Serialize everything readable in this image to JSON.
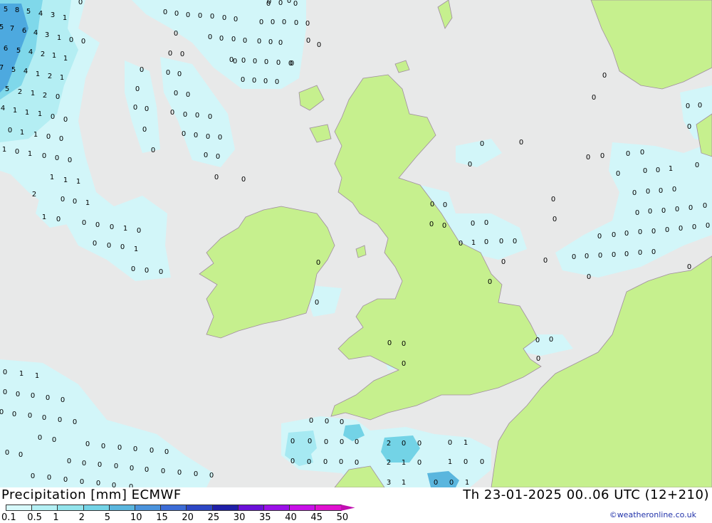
{
  "title": {
    "left": "Precipitation [mm] ECMWF",
    "right": "Th 23-01-2025 00..06 UTC (12+210)"
  },
  "credit": "©weatheronline.co.uk",
  "colors": {
    "sea": "#e8e9e9",
    "land": "#c6f08e",
    "coast": "#a08da0"
  },
  "legend": {
    "ticks": [
      "0.1",
      "0.5",
      "1",
      "2",
      "5",
      "10",
      "15",
      "20",
      "25",
      "30",
      "35",
      "40",
      "45",
      "50"
    ],
    "colors": [
      "#d7f9fb",
      "#b4f0f4",
      "#93e4ec",
      "#73d3e6",
      "#5ab6de",
      "#4a93dc",
      "#3c6cd6",
      "#2c46c4",
      "#1f1fa8",
      "#6a10d8",
      "#9a10e8",
      "#c810e8",
      "#e010d0",
      "#c010b0"
    ]
  },
  "map_values": [
    {
      "t": "5"
    },
    {
      "t": "8"
    },
    {
      "t": "5"
    },
    {
      "t": "4"
    },
    {
      "t": "3"
    },
    {
      "t": "1"
    },
    {
      "t": "0"
    },
    {
      "t": "5"
    },
    {
      "t": "7"
    },
    {
      "t": "6"
    },
    {
      "t": "4"
    },
    {
      "t": "3"
    },
    {
      "t": "1"
    },
    {
      "t": "0"
    },
    {
      "t": "0"
    },
    {
      "t": "6"
    },
    {
      "t": "5"
    },
    {
      "t": "4"
    },
    {
      "t": "2"
    },
    {
      "t": "1"
    },
    {
      "t": "1"
    },
    {
      "t": "7"
    },
    {
      "t": "5"
    },
    {
      "t": "4"
    },
    {
      "t": "1"
    },
    {
      "t": "2"
    },
    {
      "t": "1"
    },
    {
      "t": "5"
    },
    {
      "t": "2"
    },
    {
      "t": "1"
    },
    {
      "t": "2"
    },
    {
      "t": "0"
    },
    {
      "t": "4"
    },
    {
      "t": "1"
    },
    {
      "t": "1"
    },
    {
      "t": "1"
    },
    {
      "t": "0"
    },
    {
      "t": "0"
    },
    {
      "t": "0"
    },
    {
      "t": "1"
    },
    {
      "t": "1"
    },
    {
      "t": "0"
    },
    {
      "t": "0"
    },
    {
      "t": "1"
    },
    {
      "t": "0"
    },
    {
      "t": "1"
    },
    {
      "t": "0"
    },
    {
      "t": "0"
    },
    {
      "t": "0"
    },
    {
      "t": "1"
    },
    {
      "t": "1"
    },
    {
      "t": "1"
    },
    {
      "t": "2"
    },
    {
      "t": "0"
    },
    {
      "t": "0"
    },
    {
      "t": "1"
    },
    {
      "t": "1"
    },
    {
      "t": "0"
    },
    {
      "t": "0"
    },
    {
      "t": "0"
    },
    {
      "t": "0"
    },
    {
      "t": "1"
    },
    {
      "t": "0"
    },
    {
      "t": "0"
    },
    {
      "t": "0"
    },
    {
      "t": "0"
    },
    {
      "t": "1"
    },
    {
      "t": "0"
    },
    {
      "t": "0"
    },
    {
      "t": "0"
    },
    {
      "t": "0"
    },
    {
      "t": "0"
    },
    {
      "t": "0"
    },
    {
      "t": "0"
    },
    {
      "t": "0"
    },
    {
      "t": "0"
    },
    {
      "t": "0"
    },
    {
      "t": "0"
    },
    {
      "t": "0"
    },
    {
      "t": "0"
    },
    {
      "t": "0"
    },
    {
      "t": "0"
    },
    {
      "t": "0"
    },
    {
      "t": "0"
    },
    {
      "t": "0"
    },
    {
      "t": "0"
    },
    {
      "t": "0"
    },
    {
      "t": "0"
    },
    {
      "t": "0"
    },
    {
      "t": "0"
    },
    {
      "t": "0"
    },
    {
      "t": "0"
    },
    {
      "t": "0"
    },
    {
      "t": "0"
    },
    {
      "t": "0"
    },
    {
      "t": "0"
    },
    {
      "t": "0"
    },
    {
      "t": "0"
    },
    {
      "t": "0"
    },
    {
      "t": "0"
    },
    {
      "t": "0"
    },
    {
      "t": "0"
    },
    {
      "t": "0"
    },
    {
      "t": "0"
    },
    {
      "t": "0"
    },
    {
      "t": "0"
    },
    {
      "t": "0"
    },
    {
      "t": "0"
    },
    {
      "t": "0"
    },
    {
      "t": "0"
    },
    {
      "t": "0"
    },
    {
      "t": "0"
    },
    {
      "t": "0"
    },
    {
      "t": "0"
    },
    {
      "t": "0"
    },
    {
      "t": "0"
    },
    {
      "t": "0"
    },
    {
      "t": "0"
    },
    {
      "t": "0"
    },
    {
      "t": "0"
    },
    {
      "t": "0"
    },
    {
      "t": "0"
    },
    {
      "t": "0"
    },
    {
      "t": "0"
    },
    {
      "t": "0"
    },
    {
      "t": "0"
    },
    {
      "t": "0"
    },
    {
      "t": "0"
    },
    {
      "t": "0"
    },
    {
      "t": "0"
    },
    {
      "t": "0"
    },
    {
      "t": "0"
    },
    {
      "t": "0"
    },
    {
      "t": "0"
    },
    {
      "t": "0"
    },
    {
      "t": "0"
    },
    {
      "t": "0"
    },
    {
      "t": "0"
    },
    {
      "t": "0"
    },
    {
      "t": "0"
    },
    {
      "t": "0"
    },
    {
      "t": "0"
    },
    {
      "t": "0"
    },
    {
      "t": "0"
    },
    {
      "t": "0"
    },
    {
      "t": "0"
    },
    {
      "t": "0"
    },
    {
      "t": "0"
    },
    {
      "t": "1"
    },
    {
      "t": "0"
    },
    {
      "t": "0"
    },
    {
      "t": "0"
    },
    {
      "t": "0"
    },
    {
      "t": "0"
    },
    {
      "t": "0"
    },
    {
      "t": "0"
    },
    {
      "t": "0"
    },
    {
      "t": "0"
    },
    {
      "t": "0"
    },
    {
      "t": "0"
    },
    {
      "t": "0"
    },
    {
      "t": "0"
    },
    {
      "t": "0"
    },
    {
      "t": "0"
    },
    {
      "t": "0"
    },
    {
      "t": "0"
    },
    {
      "t": "0"
    },
    {
      "t": "0"
    },
    {
      "t": "0"
    },
    {
      "t": "0"
    },
    {
      "t": "0"
    },
    {
      "t": "0"
    },
    {
      "t": "0"
    },
    {
      "t": "0"
    },
    {
      "t": "0"
    },
    {
      "t": "0"
    },
    {
      "t": "0"
    },
    {
      "t": "0"
    },
    {
      "t": "1"
    },
    {
      "t": "0"
    },
    {
      "t": "0"
    },
    {
      "t": "0"
    },
    {
      "t": "0"
    },
    {
      "t": "0"
    },
    {
      "t": "0"
    },
    {
      "t": "0"
    },
    {
      "t": "0"
    },
    {
      "t": "0"
    },
    {
      "t": "0"
    },
    {
      "t": "0"
    },
    {
      "t": "0"
    },
    {
      "t": "0"
    },
    {
      "t": "0"
    },
    {
      "t": "0"
    },
    {
      "t": "0"
    },
    {
      "t": "0"
    },
    {
      "t": "0"
    },
    {
      "t": "0"
    },
    {
      "t": "0"
    },
    {
      "t": "0"
    },
    {
      "t": "0"
    },
    {
      "t": "0"
    },
    {
      "t": "0"
    },
    {
      "t": "1"
    },
    {
      "t": "1"
    },
    {
      "t": "0"
    },
    {
      "t": "0"
    },
    {
      "t": "0"
    },
    {
      "t": "0"
    },
    {
      "t": "0"
    },
    {
      "t": "0"
    },
    {
      "t": "0"
    },
    {
      "t": "0"
    },
    {
      "t": "0"
    },
    {
      "t": "0"
    },
    {
      "t": "0"
    },
    {
      "t": "0"
    },
    {
      "t": "0"
    },
    {
      "t": "0"
    },
    {
      "t": "0"
    },
    {
      "t": "0"
    },
    {
      "t": "0"
    },
    {
      "t": "0"
    },
    {
      "t": "0"
    },
    {
      "t": "0"
    },
    {
      "t": "0"
    },
    {
      "t": "0"
    },
    {
      "t": "0"
    },
    {
      "t": "0"
    },
    {
      "t": "0"
    },
    {
      "t": "0"
    },
    {
      "t": "0"
    },
    {
      "t": "0"
    },
    {
      "t": "0"
    },
    {
      "t": "0"
    },
    {
      "t": "0"
    },
    {
      "t": "0"
    },
    {
      "t": "0"
    },
    {
      "t": "0"
    },
    {
      "t": "0"
    },
    {
      "t": "0"
    },
    {
      "t": "0"
    },
    {
      "t": "0"
    },
    {
      "t": "0"
    },
    {
      "t": "0"
    },
    {
      "t": "0"
    },
    {
      "t": "0"
    },
    {
      "t": "0"
    },
    {
      "t": "0"
    },
    {
      "t": "0"
    },
    {
      "t": "0"
    },
    {
      "t": "0"
    },
    {
      "t": "0"
    },
    {
      "t": "0"
    },
    {
      "t": "0"
    },
    {
      "t": "0"
    },
    {
      "t": "2"
    },
    {
      "t": "0"
    },
    {
      "t": "0"
    },
    {
      "t": "0"
    },
    {
      "t": "1"
    },
    {
      "t": "2"
    },
    {
      "t": "1"
    },
    {
      "t": "0"
    },
    {
      "t": "1"
    },
    {
      "t": "0"
    },
    {
      "t": "0"
    },
    {
      "t": "3"
    },
    {
      "t": "1"
    },
    {
      "t": "0"
    },
    {
      "t": "0"
    },
    {
      "t": "1"
    },
    {
      "t": "1"
    },
    {
      "t": "1"
    },
    {
      "t": "0"
    },
    {
      "t": "1"
    },
    {
      "t": "1"
    },
    {
      "t": "0"
    },
    {
      "t": "1"
    },
    {
      "t": "4"
    },
    {
      "t": "5"
    },
    {
      "t": "0"
    }
  ]
}
